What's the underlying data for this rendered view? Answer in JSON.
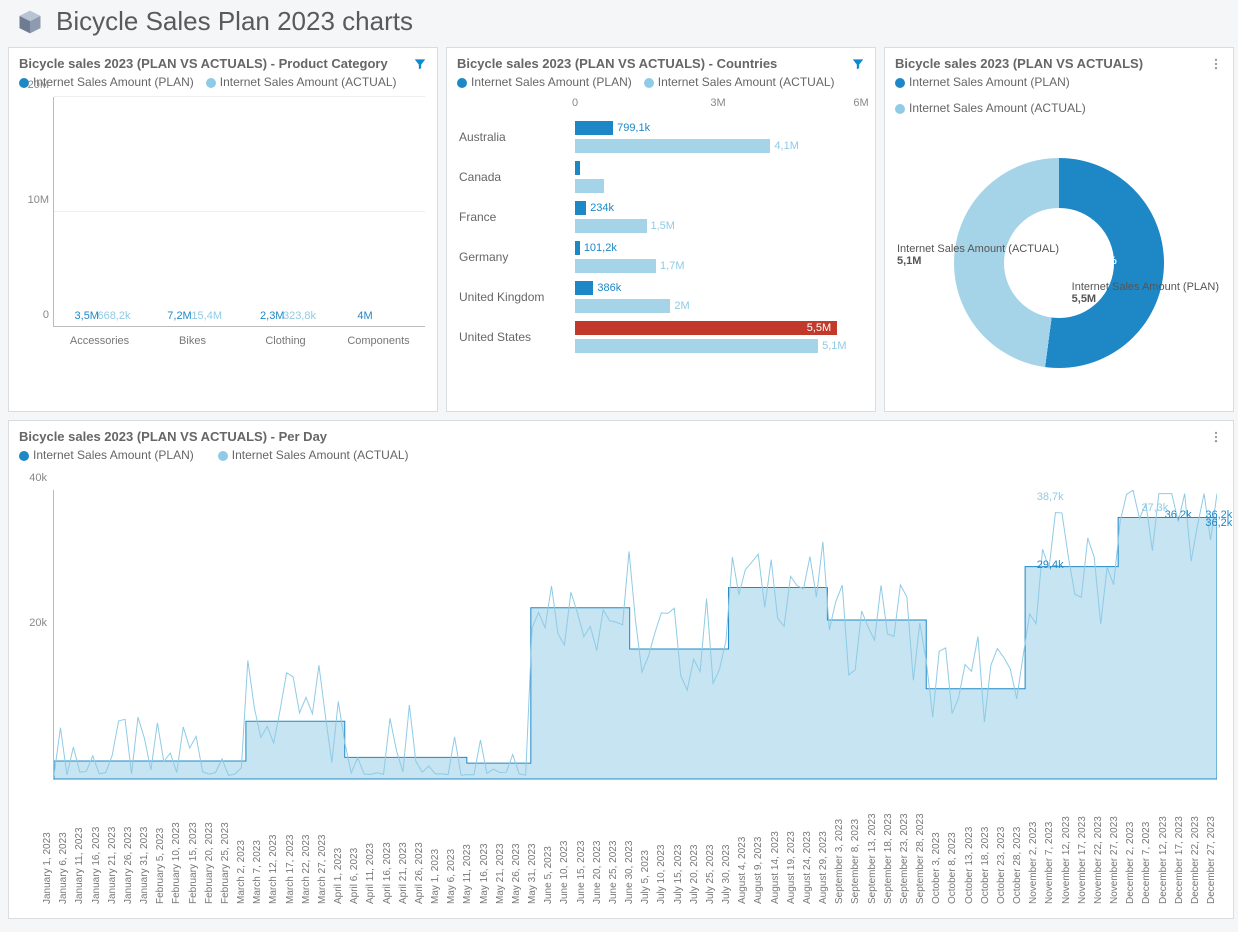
{
  "page_title": "Bicycle Sales Plan 2023 charts",
  "legend": {
    "plan": "Internet Sales Amount (PLAN)",
    "actual": "Internet Sales Amount (ACTUAL)"
  },
  "cards": {
    "product": {
      "title": "Bicycle sales 2023 (PLAN VS ACTUALS) - Product Category"
    },
    "countries": {
      "title": "Bicycle sales 2023 (PLAN VS ACTUALS) - Countries"
    },
    "donut": {
      "title": "Bicycle sales 2023 (PLAN VS ACTUALS)"
    },
    "perday": {
      "title": "Bicycle sales 2023 (PLAN VS ACTUALS) - Per Day"
    }
  },
  "donut_labels": {
    "actual_name": "Internet Sales Amount (ACTUAL)",
    "actual_val": "5,1M",
    "plan_name": "Internet Sales Amount (PLAN)",
    "plan_val": "5,5M",
    "plan_pct": "52.1%"
  },
  "perday_end_labels": [
    "38,7k",
    "29,4k",
    "37,3k",
    "36,2k",
    "36,2k",
    "36,2k"
  ],
  "chart_data": [
    {
      "id": "product_category",
      "type": "bar",
      "orientation": "vertical",
      "title": "Bicycle sales 2023 (PLAN VS ACTUALS) - Product Category",
      "categories": [
        "Accessories",
        "Bikes",
        "Clothing",
        "Components"
      ],
      "series": [
        {
          "name": "Internet Sales Amount (PLAN)",
          "values": [
            3500000,
            7200000,
            2300000,
            4000000
          ],
          "labels": [
            "3,5M",
            "7,2M",
            "2,3M",
            "4M"
          ]
        },
        {
          "name": "Internet Sales Amount (ACTUAL)",
          "values": [
            668200,
            15400000,
            323800,
            0
          ],
          "labels": [
            "668,2k",
            "15,4M",
            "323,8k",
            ""
          ]
        }
      ],
      "ylim": [
        0,
        20000000
      ],
      "yticks": [
        0,
        10000000,
        20000000
      ],
      "ytick_labels": [
        "0",
        "10M",
        "20M"
      ],
      "highlight": {
        "series": 1,
        "index": 1
      }
    },
    {
      "id": "countries",
      "type": "bar",
      "orientation": "horizontal",
      "title": "Bicycle sales 2023 (PLAN VS ACTUALS) - Countries",
      "categories": [
        "Australia",
        "Canada",
        "France",
        "Germany",
        "United Kingdom",
        "United States"
      ],
      "series": [
        {
          "name": "Internet Sales Amount (PLAN)",
          "values": [
            799100,
            100000,
            234000,
            101200,
            386000,
            5500000
          ],
          "labels": [
            "799,1k",
            "",
            "234k",
            "101,2k",
            "386k",
            "5,5M"
          ]
        },
        {
          "name": "Internet Sales Amount (ACTUAL)",
          "values": [
            4100000,
            600000,
            1500000,
            1700000,
            2000000,
            5100000
          ],
          "labels": [
            "4,1M",
            "",
            "1,5M",
            "1,7M",
            "2M",
            "5,1M"
          ]
        }
      ],
      "xlim": [
        0,
        6000000
      ],
      "xticks": [
        0,
        3000000,
        6000000
      ],
      "xtick_labels": [
        "0",
        "3M",
        "6M"
      ],
      "highlight": {
        "series": 0,
        "index": 5
      }
    },
    {
      "id": "donut",
      "type": "pie",
      "subtype": "donut",
      "title": "Bicycle sales 2023 (PLAN VS ACTUALS)",
      "slices": [
        {
          "name": "Internet Sales Amount (PLAN)",
          "value": 5500000,
          "label": "5,5M",
          "pct": 52.1
        },
        {
          "name": "Internet Sales Amount (ACTUAL)",
          "value": 5100000,
          "label": "5,1M",
          "pct": 47.9
        }
      ]
    },
    {
      "id": "per_day",
      "type": "area+line",
      "title": "Bicycle sales 2023 (PLAN VS ACTUALS) - Per Day",
      "ylim": [
        0,
        40000
      ],
      "yticks": [
        20000,
        40000
      ],
      "ytick_labels": [
        "20k",
        "40k"
      ],
      "x_tick_labels": [
        "January 1, 2023",
        "January 6, 2023",
        "January 11, 2023",
        "January 16, 2023",
        "January 21, 2023",
        "January 26, 2023",
        "January 31, 2023",
        "February 5, 2023",
        "February 10, 2023",
        "February 15, 2023",
        "February 20, 2023",
        "February 25, 2023",
        "March 2, 2023",
        "March 7, 2023",
        "March 12, 2023",
        "March 17, 2023",
        "March 22, 2023",
        "March 27, 2023",
        "April 1, 2023",
        "April 6, 2023",
        "April 11, 2023",
        "April 16, 2023",
        "April 21, 2023",
        "April 26, 2023",
        "May 1, 2023",
        "May 6, 2023",
        "May 11, 2023",
        "May 16, 2023",
        "May 21, 2023",
        "May 26, 2023",
        "May 31, 2023",
        "June 5, 2023",
        "June 10, 2023",
        "June 15, 2023",
        "June 20, 2023",
        "June 25, 2023",
        "June 30, 2023",
        "July 5, 2023",
        "July 10, 2023",
        "July 15, 2023",
        "July 20, 2023",
        "July 25, 2023",
        "July 30, 2023",
        "August 4, 2023",
        "August 9, 2023",
        "August 14, 2023",
        "August 19, 2023",
        "August 24, 2023",
        "August 29, 2023",
        "September 3, 2023",
        "September 8, 2023",
        "September 13, 2023",
        "September 18, 2023",
        "September 23, 2023",
        "September 28, 2023",
        "October 3, 2023",
        "October 8, 2023",
        "October 13, 2023",
        "October 18, 2023",
        "October 23, 2023",
        "October 28, 2023",
        "November 2, 2023",
        "November 7, 2023",
        "November 12, 2023",
        "November 17, 2023",
        "November 22, 2023",
        "November 27, 2023",
        "December 2, 2023",
        "December 7, 2023",
        "December 12, 2023",
        "December 17, 2023",
        "December 22, 2023",
        "December 27, 2023"
      ],
      "plan_steps": [
        {
          "x": 0.0,
          "y": 2500
        },
        {
          "x": 0.165,
          "y": 2500
        },
        {
          "x": 0.165,
          "y": 8000
        },
        {
          "x": 0.25,
          "y": 8000
        },
        {
          "x": 0.25,
          "y": 3000
        },
        {
          "x": 0.355,
          "y": 3000
        },
        {
          "x": 0.355,
          "y": 2200
        },
        {
          "x": 0.41,
          "y": 2200
        },
        {
          "x": 0.41,
          "y": 23700
        },
        {
          "x": 0.495,
          "y": 23700
        },
        {
          "x": 0.495,
          "y": 18000
        },
        {
          "x": 0.58,
          "y": 18000
        },
        {
          "x": 0.58,
          "y": 26500
        },
        {
          "x": 0.665,
          "y": 26500
        },
        {
          "x": 0.665,
          "y": 22000
        },
        {
          "x": 0.75,
          "y": 22000
        },
        {
          "x": 0.75,
          "y": 12500
        },
        {
          "x": 0.835,
          "y": 12500
        },
        {
          "x": 0.835,
          "y": 29400
        },
        {
          "x": 0.915,
          "y": 29400
        },
        {
          "x": 0.915,
          "y": 36200
        },
        {
          "x": 1.0,
          "y": 36200
        }
      ],
      "actual_noise": {
        "amp": 7000,
        "segments": 180
      },
      "end_labels": [
        {
          "text": "38,7k",
          "x": 0.845,
          "y": 38700
        },
        {
          "text": "29,4k",
          "x": 0.845,
          "y": 29400
        },
        {
          "text": "37,3k",
          "x": 0.935,
          "y": 37300
        },
        {
          "text": "36,2k",
          "x": 0.955,
          "y": 36200
        },
        {
          "text": "36,2k",
          "x": 0.99,
          "y": 36200
        },
        {
          "text": "36,2k",
          "x": 0.99,
          "y": 35200
        }
      ]
    }
  ]
}
